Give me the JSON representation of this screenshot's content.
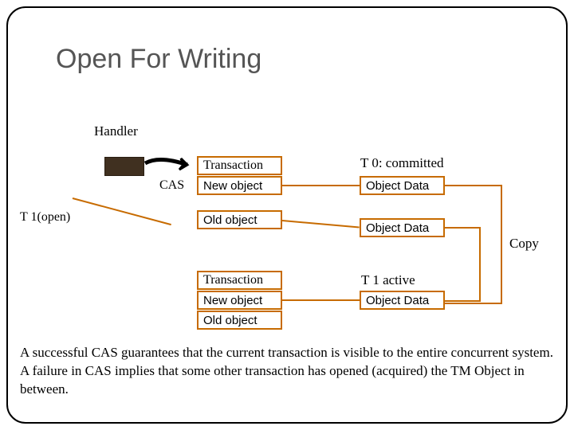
{
  "title": "Open For Writing",
  "labels": {
    "handler": "Handler",
    "cas": "CAS",
    "t1open": "T 1(open)",
    "copy": "Copy"
  },
  "block1": {
    "transaction": "Transaction",
    "new_object": "New object",
    "old_object": "Old object",
    "t0": "T 0: committed",
    "objdata1": "Object Data",
    "objdata2": "Object Data"
  },
  "block2": {
    "transaction": "Transaction",
    "new_object": "New object",
    "old_object": "Old object",
    "t1active": "T 1 active",
    "objdata": "Object Data"
  },
  "caption": "A successful CAS guarantees that the current transaction is visible to the entire concurrent system. A failure in CAS implies that some other transaction has opened (acquired) the TM Object in between."
}
